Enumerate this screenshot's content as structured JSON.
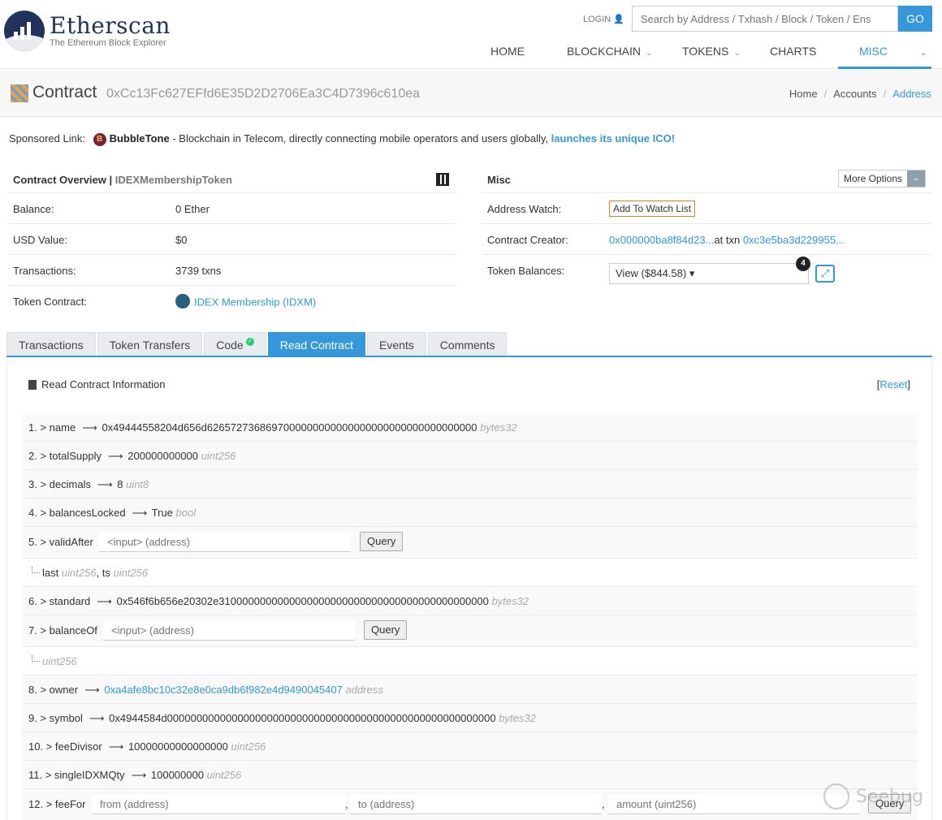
{
  "brand": {
    "title": "Etherscan",
    "subtitle": "The Ethereum Block Explorer"
  },
  "header": {
    "login": "LOGIN",
    "search_placeholder": "Search by Address / Txhash / Block / Token / Ens",
    "go": "GO",
    "nav": [
      "HOME",
      "BLOCKCHAIN",
      "TOKENS",
      "CHARTS",
      "MISC"
    ]
  },
  "titlebar": {
    "label": "Contract",
    "hash": "0xCc13Fc627EFfd6E35D2D2706Ea3C4D7396c610ea",
    "breadcrumb": [
      "Home",
      "Accounts",
      "Address"
    ]
  },
  "sponsored": {
    "label": "Sponsored Link:",
    "badge": "B",
    "name": "BubbleTone",
    "text": " - Blockchain in Telecom, directly connecting mobile operators and users globally, ",
    "link": "launches its unique ICO!"
  },
  "overview": {
    "title": "Contract Overview",
    "sep": " | ",
    "subtitle": "IDEXMembershipToken",
    "rows": [
      {
        "k": "Balance:",
        "v": "0 Ether"
      },
      {
        "k": "USD Value:",
        "v": "$0"
      },
      {
        "k": "Transactions:",
        "v": "3739 txns"
      },
      {
        "k": "Token Contract:",
        "v": "IDEX Membership (IDXM)"
      }
    ]
  },
  "misc": {
    "title": "Misc",
    "more_options": "More Options",
    "watch_label": "Address Watch:",
    "watch_btn": "Add To Watch List",
    "creator_label": "Contract Creator:",
    "creator_addr": "0x000000ba8f84d23...",
    "creator_at": "at txn",
    "creator_txn": "0xc3e5ba3d229955...",
    "balances_label": "Token Balances:",
    "balances_value": "View ($844.58) ▾",
    "balances_count": "4"
  },
  "tabs": [
    "Transactions",
    "Token Transfers",
    "Code",
    "Read Contract",
    "Events",
    "Comments"
  ],
  "read_contract": {
    "title": "Read Contract Information",
    "reset_open": "[",
    "reset": "Reset",
    "reset_close": "]",
    "rows": [
      {
        "label": "1. > name",
        "value": "0x49444558204d656d6265727368697000000000000000000000000000000000",
        "type": "bytes32"
      },
      {
        "label": "2. > totalSupply",
        "value": "200000000000",
        "type": "uint256"
      },
      {
        "label": "3. > decimals",
        "value": "8",
        "type": "uint8"
      },
      {
        "label": "4. > balancesLocked",
        "value": "True",
        "type": "bool"
      },
      {
        "label": "5. > validAfter",
        "input": "<input> (address)",
        "button": "Query",
        "sub_a": "last",
        "sub_a_type": "uint256",
        "sub_b": ", ts",
        "sub_b_type": "uint256"
      },
      {
        "label": "6. > standard",
        "value": "0x546f6b656e20302e3100000000000000000000000000000000000000000000",
        "type": "bytes32"
      },
      {
        "label": "7. > balanceOf",
        "input": "<input> (address)",
        "button": "Query",
        "sub_type": "uint256"
      },
      {
        "label": "8. > owner",
        "value": "0xa4afe8bc10c32e8e0ca9db6f982e4d9490045407",
        "type": "address"
      },
      {
        "label": "9. > symbol",
        "value": "0x4944584d00000000000000000000000000000000000000000000000000000000",
        "type": "bytes32"
      },
      {
        "label": "10. > feeDivisor",
        "value": "10000000000000000",
        "type": "uint256"
      },
      {
        "label": "11. > singleIDXMQty",
        "value": "100000000",
        "type": "uint256"
      },
      {
        "label": "12. > feeFor",
        "input_from": "from (address)",
        "input_to": "to (address)",
        "input_amount": "amount (uint256)",
        "button": "Query",
        "comma": ","
      }
    ]
  },
  "watermark": "Seebug",
  "colors": {
    "accent": "#3498db",
    "navy": "#21325b",
    "watch_border": "#e67e22"
  }
}
